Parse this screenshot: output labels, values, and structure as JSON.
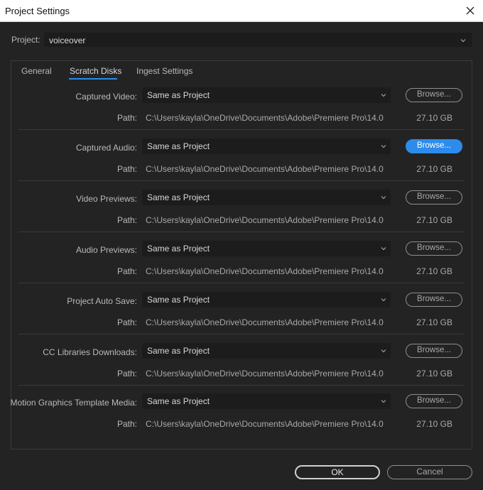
{
  "window": {
    "title": "Project Settings"
  },
  "project": {
    "label": "Project:",
    "value": "voiceover"
  },
  "tabs": [
    {
      "label": "General",
      "active": false
    },
    {
      "label": "Scratch Disks",
      "active": true
    },
    {
      "label": "Ingest Settings",
      "active": false
    }
  ],
  "sections": [
    {
      "label": "Captured Video:",
      "select": "Same as Project",
      "browse": "Browse...",
      "browse_primary": false,
      "path_label": "Path:",
      "path": "C:\\Users\\kayla\\OneDrive\\Documents\\Adobe\\Premiere Pro\\14.0",
      "size": "27.10 GB"
    },
    {
      "label": "Captured Audio:",
      "select": "Same as Project",
      "browse": "Browse...",
      "browse_primary": true,
      "path_label": "Path:",
      "path": "C:\\Users\\kayla\\OneDrive\\Documents\\Adobe\\Premiere Pro\\14.0",
      "size": "27.10 GB"
    },
    {
      "label": "Video Previews:",
      "select": "Same as Project",
      "browse": "Browse...",
      "browse_primary": false,
      "path_label": "Path:",
      "path": "C:\\Users\\kayla\\OneDrive\\Documents\\Adobe\\Premiere Pro\\14.0",
      "size": "27.10 GB"
    },
    {
      "label": "Audio Previews:",
      "select": "Same as Project",
      "browse": "Browse...",
      "browse_primary": false,
      "path_label": "Path:",
      "path": "C:\\Users\\kayla\\OneDrive\\Documents\\Adobe\\Premiere Pro\\14.0",
      "size": "27.10 GB"
    },
    {
      "label": "Project Auto Save:",
      "select": "Same as Project",
      "browse": "Browse...",
      "browse_primary": false,
      "path_label": "Path:",
      "path": "C:\\Users\\kayla\\OneDrive\\Documents\\Adobe\\Premiere Pro\\14.0",
      "size": "27.10 GB"
    },
    {
      "label": "CC Libraries Downloads:",
      "select": "Same as Project",
      "browse": "Browse...",
      "browse_primary": false,
      "path_label": "Path:",
      "path": "C:\\Users\\kayla\\OneDrive\\Documents\\Adobe\\Premiere Pro\\14.0",
      "size": "27.10 GB"
    },
    {
      "label": "Motion Graphics Template Media:",
      "select": "Same as Project",
      "browse": "Browse...",
      "browse_primary": false,
      "path_label": "Path:",
      "path": "C:\\Users\\kayla\\OneDrive\\Documents\\Adobe\\Premiere Pro\\14.0",
      "size": "27.10 GB"
    }
  ],
  "buttons": {
    "ok": "OK",
    "cancel": "Cancel"
  },
  "icons": {
    "close": "close-icon",
    "dropdown": "chevron-down-icon"
  },
  "colors": {
    "accent": "#2d8ceb",
    "background": "#232323",
    "field": "#1c1c1c"
  }
}
